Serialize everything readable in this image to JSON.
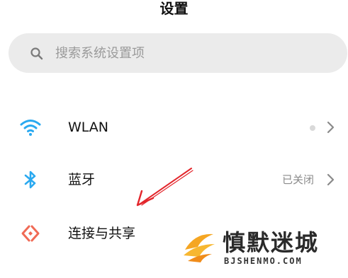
{
  "header": {
    "title": "设置"
  },
  "search": {
    "placeholder": "搜索系统设置项"
  },
  "settings": {
    "items": [
      {
        "label": "WLAN",
        "value": ""
      },
      {
        "label": "蓝牙",
        "value": "已关闭"
      },
      {
        "label": "连接与共享",
        "value": ""
      }
    ]
  },
  "icons": {
    "search": "search-icon",
    "wlan": "wifi-icon",
    "bluetooth": "bluetooth-icon",
    "connection": "connection-share-icon",
    "chevron": "chevron-right-icon"
  },
  "colors": {
    "accent": "#2aa9f0",
    "connection_icon": "#f06a55",
    "annotation_arrow": "#e3262c",
    "watermark_logo": "#f5a623"
  },
  "watermark": {
    "name": "慎默迷城",
    "url": "BJSHENMO.COM"
  }
}
